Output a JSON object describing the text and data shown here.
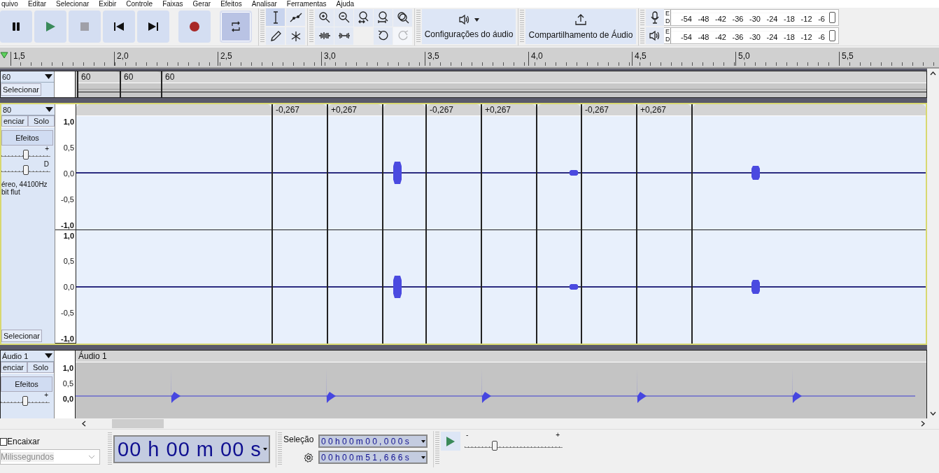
{
  "menu": [
    "quivo",
    "Editar",
    "Selecionar",
    "Exibir",
    "Controle",
    "Faixas",
    "Gerar",
    "Efeitos",
    "Analisar",
    "Ferramentas",
    "Ajuda"
  ],
  "transport": [
    {
      "kind": "pause",
      "on": false
    },
    {
      "kind": "play",
      "on": false
    },
    {
      "kind": "stop",
      "on": false
    },
    {
      "kind": "skip-start",
      "on": false
    },
    {
      "kind": "skip-end",
      "on": false
    },
    {
      "kind": "record",
      "on": false
    },
    {
      "kind": "loop",
      "on": true
    }
  ],
  "tools": [
    {
      "kind": "select",
      "selected": true
    },
    {
      "kind": "envelope",
      "selected": false
    },
    {
      "kind": "draw",
      "selected": false
    },
    {
      "kind": "multi",
      "selected": false
    }
  ],
  "edit_tools": [
    {
      "kind": "zoom-in",
      "disabled": false
    },
    {
      "kind": "zoom-out",
      "disabled": false
    },
    {
      "kind": "fit-selection",
      "disabled": false
    },
    {
      "kind": "fit-project",
      "disabled": false
    },
    {
      "kind": "zoom-toggle",
      "disabled": false
    },
    {
      "kind": "trim",
      "disabled": false
    },
    {
      "kind": "silence",
      "disabled": false
    },
    {
      "kind": "undo",
      "disabled": false
    },
    {
      "kind": "redo",
      "disabled": true
    }
  ],
  "audio_setup": {
    "label": "Configurações do áudio"
  },
  "share_audio": {
    "label": "Compartilhamento de Áudio"
  },
  "meters": [
    {
      "kind": "record",
      "channels": [
        "E",
        "D"
      ],
      "scale": [
        "-54",
        "-48",
        "-42",
        "-36",
        "-30",
        "-24",
        "-18",
        "-12",
        "-6"
      ]
    },
    {
      "kind": "playback",
      "channels": [
        "E",
        "D"
      ],
      "scale": [
        "-54",
        "-48",
        "-42",
        "-36",
        "-30",
        "-24",
        "-18",
        "-12",
        "-6"
      ]
    }
  ],
  "ruler": {
    "ticks": [
      "1,5",
      "2,0",
      "2,5",
      "3,0",
      "3,5",
      "4,0",
      "4,5",
      "5,0",
      "5,5"
    ]
  },
  "tracks": [
    {
      "kind": "minimized",
      "name": "60",
      "selected": false,
      "focused": false,
      "select_button": "Selecionar",
      "clips": [
        {
          "kind": "titled",
          "title": "60"
        },
        {
          "kind": "titled",
          "title": "60"
        },
        {
          "kind": "titled",
          "title": "60"
        }
      ]
    },
    {
      "kind": "stereo",
      "name": "80",
      "selected": true,
      "focused": true,
      "mute_button": "enciar",
      "solo_button": "Solo",
      "effects_button": "Efeitos",
      "gain": {
        "label": "+",
        "level": 0.5
      },
      "pan": {
        "label": "D",
        "level": 0.5
      },
      "info": [
        "éreo, 44100Hz",
        "bit flut"
      ],
      "select_button": "Selecionar",
      "channels": [
        {
          "scale": [
            "1,0",
            "0,5",
            "0,0",
            "-0,5",
            "-1,0"
          ]
        },
        {
          "scale": [
            "1,0",
            "0,5",
            "0,0",
            "-0,5",
            "-1,0"
          ]
        }
      ],
      "clips": [
        {
          "kind": "untitled"
        },
        {
          "kind": "titled",
          "title": "-0,267"
        },
        {
          "kind": "titled",
          "title": "+0,267"
        },
        {
          "kind": "untitled"
        },
        {
          "kind": "titled",
          "title": "-0,267"
        },
        {
          "kind": "titled",
          "title": "+0,267"
        },
        {
          "kind": "untitled"
        },
        {
          "kind": "titled",
          "title": "-0,267"
        },
        {
          "kind": "titled",
          "title": "+0,267"
        },
        {
          "kind": "untitled"
        }
      ]
    },
    {
      "kind": "mono",
      "name": "Áudio 1",
      "selected": false,
      "focused": false,
      "mute_button": "enciar",
      "solo_button": "Solo",
      "effects_button": "Efeitos",
      "gain": {
        "label": "+",
        "level": 0.5
      },
      "channels": [
        {
          "scale": [
            "1,0",
            "0,5",
            "0,0"
          ]
        }
      ],
      "clips": [
        {
          "kind": "titled",
          "title": "Áudio 1"
        }
      ]
    }
  ],
  "bottom": {
    "snap": {
      "label": "Encaixar",
      "checked": false
    },
    "snap_unit": {
      "value": "Milissegundos",
      "disabled": true
    },
    "time": "00 h 00 m 00 s",
    "selection": {
      "label": "Seleção",
      "start": "00h00m00,000s",
      "end": "00h00m51,666s"
    },
    "play_at_speed": {
      "min_label": "-",
      "max_label": "+",
      "level": 0.31
    }
  }
}
